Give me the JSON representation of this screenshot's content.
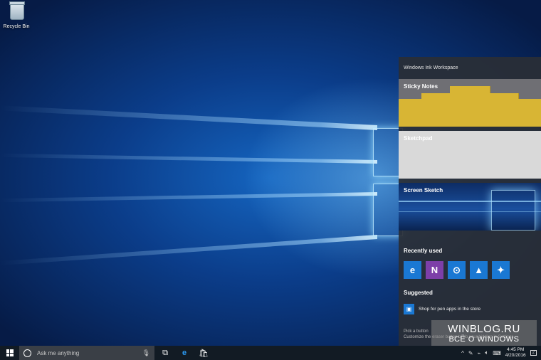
{
  "desktop": {
    "recycle_bin_label": "Recycle Bin"
  },
  "ink_workspace": {
    "title": "Windows Ink Workspace",
    "cards": {
      "sticky_notes": "Sticky Notes",
      "sketchpad": "Sketchpad",
      "screen_sketch": "Screen Sketch"
    },
    "recently_used_label": "Recently used",
    "recent_apps": [
      {
        "name": "edge-icon",
        "glyph": "e"
      },
      {
        "name": "onenote-icon",
        "glyph": "N"
      },
      {
        "name": "maps-icon",
        "glyph": "⊙"
      },
      {
        "name": "photos-icon",
        "glyph": "▲"
      },
      {
        "name": "tips-icon",
        "glyph": "✦"
      }
    ],
    "suggested_label": "Suggested",
    "suggestion_text": "Shop for pen apps in the store",
    "pen_text_line1": "Pick a button",
    "pen_text_line2": "Customize the eraser button to do your bidding in Settings"
  },
  "watermark": {
    "line1": "WINBLOG.RU",
    "line2": "ВСЁ О WINDOWS"
  },
  "taskbar": {
    "search_placeholder": "Ask me anything",
    "clock_time": "4:45 PM",
    "clock_date": "4/20/2016",
    "notification_count": "2"
  }
}
